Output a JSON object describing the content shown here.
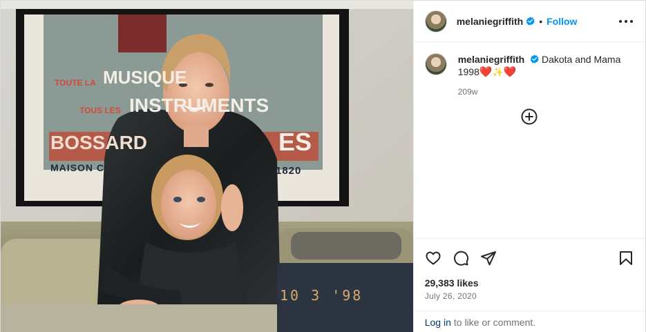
{
  "post": {
    "username": "melaniegriffith",
    "follow_label": "Follow",
    "separator": "•",
    "caption_text": "Dakota and Mama 1998",
    "caption_emoji_1": "❤️",
    "caption_emoji_2": "✨",
    "caption_emoji_3": "❤️",
    "age": "209w",
    "likes": "29,383 likes",
    "date": "July 26, 2020",
    "login_link": "Log in",
    "login_rest": "to like or comment."
  },
  "photo": {
    "poster_lines": [
      "TOUTE LA",
      "MUSIQUE",
      "TOUS LES",
      "INSTRUMENTS",
      "BOSSARD",
      "ES",
      "MAISON C",
      "1820"
    ],
    "date_stamp": "10 3 '98"
  },
  "icons": {
    "verified": "verified-badge-icon",
    "more": "more-options-icon",
    "load_more": "add-circle-icon",
    "like": "heart-icon",
    "comment": "comment-icon",
    "share": "share-icon",
    "save": "bookmark-icon"
  },
  "colors": {
    "accent": "#0095f6",
    "text": "#262626",
    "secondary": "#737373",
    "link": "#00376b",
    "border": "#efefef"
  }
}
